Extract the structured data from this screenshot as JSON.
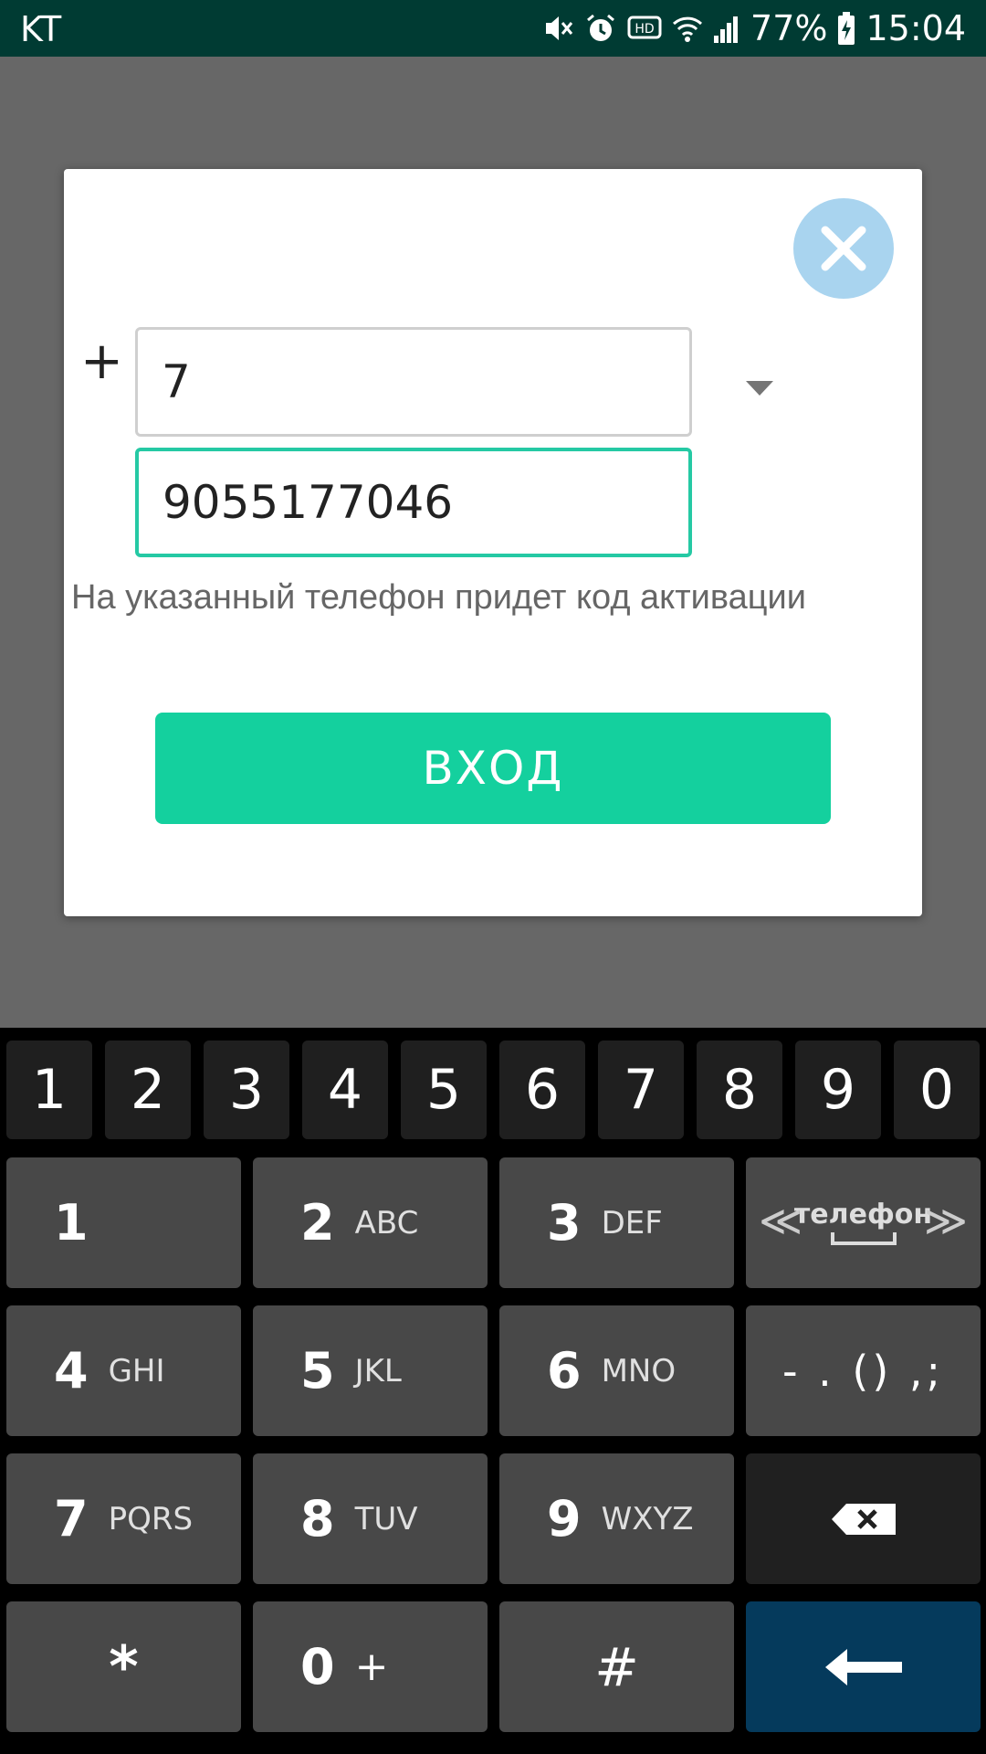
{
  "status_bar": {
    "carrier": "KT",
    "battery_percent": "77%",
    "time": "15:04",
    "icons": [
      "mute-icon",
      "alarm-icon",
      "hd-voice-icon",
      "wifi-icon",
      "signal-icon",
      "battery-icon"
    ]
  },
  "dialog": {
    "plus": "+",
    "country_code_value": "7",
    "phone_value": "9055177046",
    "hint": "На указанный телефон придет код активации",
    "login_button": "ВХОД",
    "close_icon": "close-icon",
    "dropdown_icon": "dropdown-arrow-icon"
  },
  "colors": {
    "status_bar": "#003b33",
    "accent": "#14d09e",
    "focus_border": "#25c9a4",
    "close_button": "#a9d4ef",
    "enter_key": "#053a5c"
  },
  "keyboard": {
    "number_row": [
      "1",
      "2",
      "3",
      "4",
      "5",
      "6",
      "7",
      "8",
      "9",
      "0"
    ],
    "keypad": [
      {
        "num": "1",
        "letters": ""
      },
      {
        "num": "2",
        "letters": "ABC"
      },
      {
        "num": "3",
        "letters": "DEF"
      },
      {
        "num": "4",
        "letters": "GHI"
      },
      {
        "num": "5",
        "letters": "JKL"
      },
      {
        "num": "6",
        "letters": "MNO"
      },
      {
        "num": "7",
        "letters": "PQRS"
      },
      {
        "num": "8",
        "letters": "TUV"
      },
      {
        "num": "9",
        "letters": "WXYZ"
      }
    ],
    "language_label": "телефон",
    "punctuation": "- . () ,;",
    "star": "*",
    "zero": "0",
    "zero_extra": "+",
    "hash": "#"
  }
}
